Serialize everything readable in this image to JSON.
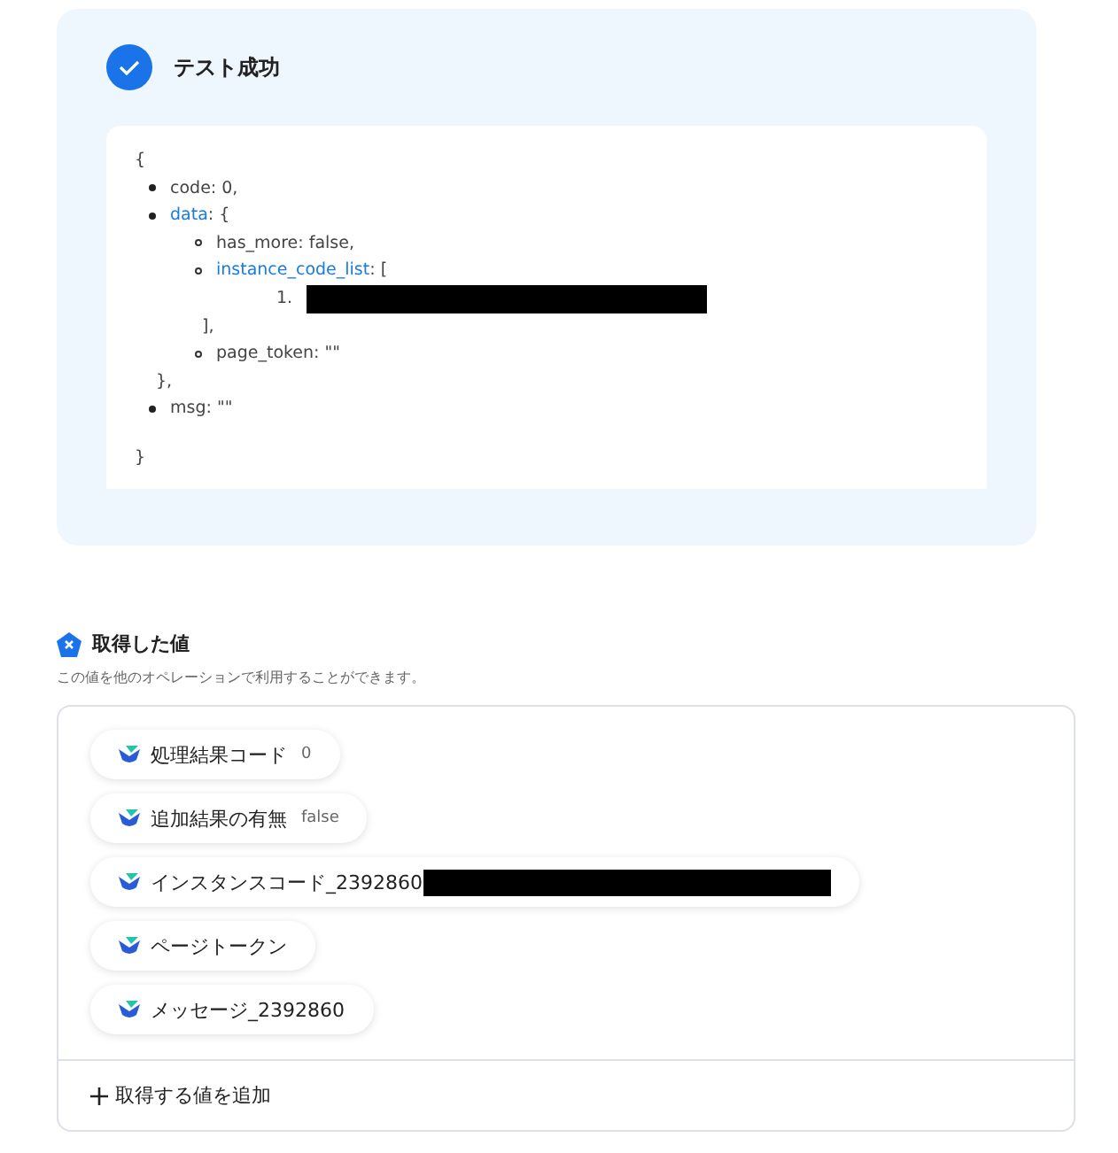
{
  "test_result": {
    "title": "テスト成功",
    "response": {
      "open": "{",
      "close": "}",
      "items": [
        {
          "text": "code: 0,"
        },
        {
          "key": "data",
          "suffix": ": {",
          "close": "},",
          "children": [
            {
              "text": "has_more: false,"
            },
            {
              "key": "instance_code_list",
              "suffix": ": [",
              "close": "],",
              "children": [
                {
                  "number": "1.",
                  "redacted": true
                }
              ]
            },
            {
              "text": "page_token: \"\""
            }
          ]
        },
        {
          "text": "msg: \"\""
        }
      ]
    }
  },
  "values": {
    "title": "取得した値",
    "description": "この値を他のオペレーションで利用することができます。",
    "chips": [
      {
        "label": "処理結果コード",
        "value": "0"
      },
      {
        "label": "追加結果の有無",
        "value": "false"
      },
      {
        "label": "インスタンスコード_2392860",
        "redacted": true
      },
      {
        "label": "ページトークン"
      },
      {
        "label": "メッセージ_2392860"
      }
    ],
    "add_button": "取得する値を追加"
  }
}
